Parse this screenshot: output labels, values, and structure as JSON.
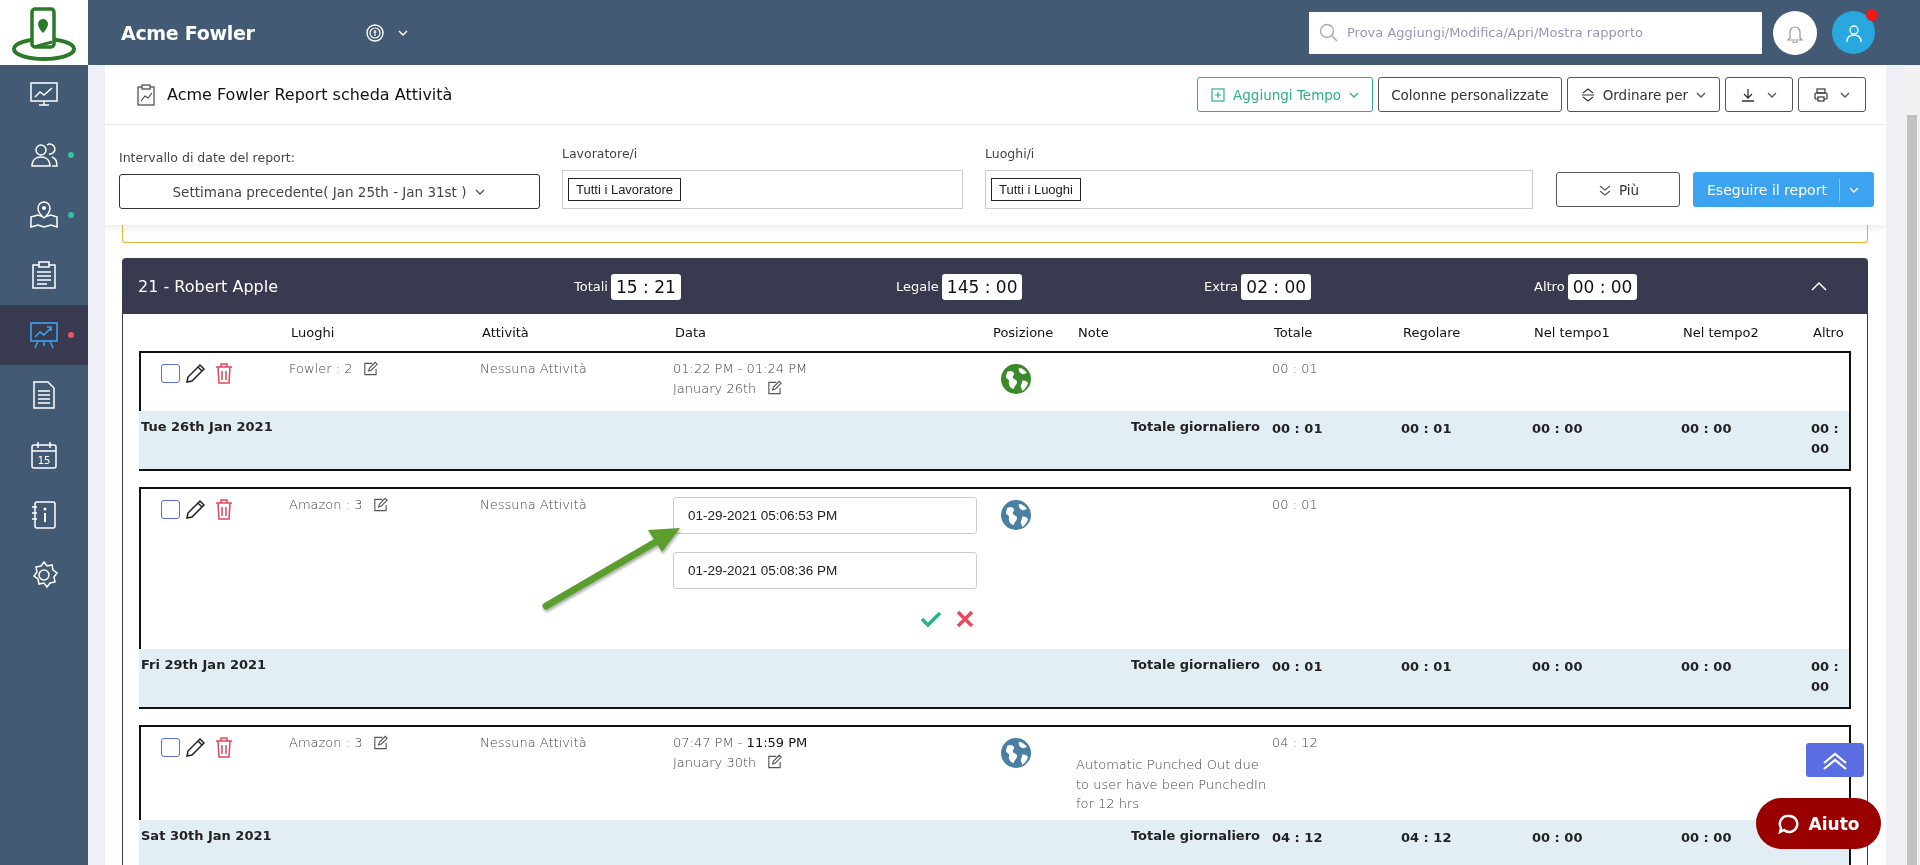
{
  "app": {
    "name": "Acme Fowler"
  },
  "search": {
    "placeholder": "Prova Aggiungi/Modifica/Apri/Mostra rapporto"
  },
  "profile": {
    "alert": true
  },
  "sidebar": {
    "items": [
      {
        "kind": "dashboard",
        "selected": false
      },
      {
        "kind": "people",
        "selected": false,
        "color": "#2ec4a0"
      },
      {
        "kind": "map",
        "selected": false,
        "color": "#2ec4a0"
      },
      {
        "kind": "clipboard",
        "selected": false
      },
      {
        "kind": "report",
        "selected": true,
        "color": "#f0506e"
      },
      {
        "kind": "document",
        "selected": false
      },
      {
        "kind": "calendar",
        "selected": false,
        "label": "15"
      },
      {
        "kind": "contacts",
        "selected": false
      },
      {
        "kind": "settings",
        "selected": false
      }
    ]
  },
  "report": {
    "title": "Acme Fowler Report scheda Attività",
    "toolbar": [
      {
        "kind": "add",
        "label": "Aggiungi Tempo",
        "dropdown": true
      },
      {
        "kind": "plain",
        "label": "Colonne personalizzate",
        "dropdown": false
      },
      {
        "kind": "sort",
        "label": "Ordinare per",
        "dropdown": true
      },
      {
        "kind": "download",
        "dropdown": true
      },
      {
        "kind": "print",
        "dropdown": true
      }
    ]
  },
  "filters": {
    "date_range": {
      "label": "Intervallo di date del report:",
      "value": "Settimana precedente( Jan 25th - Jan 31st )"
    },
    "workers": {
      "label": "Lavoratore/i",
      "tag": "Tutti i Lavoratore"
    },
    "places": {
      "label": "Luoghi/i",
      "tag": "Tutti i Luoghi"
    },
    "more_button": "Più",
    "run_button": "Eseguire il report"
  },
  "employee": {
    "name": "21 - Robert Apple",
    "expanded": true,
    "totals": [
      {
        "label": "Totali",
        "value": "15 : 21"
      },
      {
        "label": "Legale",
        "value": "145 : 00"
      },
      {
        "label": "Extra",
        "value": "02 : 00"
      },
      {
        "label": "Altro",
        "value": "00 : 00"
      }
    ],
    "columns": [
      "Luoghi",
      "Attività",
      "Data",
      "Posizione",
      "Note",
      "Totale",
      "Regolare",
      "Nel tempo1",
      "Nel tempo2",
      "Altro"
    ],
    "days": [
      {
        "entry": {
          "kind": "punch",
          "checked": false,
          "place": "Fowler : 2",
          "activity": "Nessuna Attività",
          "time": "01:22 PM - 01:24 PM",
          "date": "January 26th",
          "color": "#3b8a2a",
          "total": "00 : 01"
        },
        "summary": {
          "date": "Tue 26th Jan 2021",
          "label": "Totale giornaliero",
          "values": [
            "00 : 01",
            "00 : 01",
            "00 : 00",
            "00 : 00",
            "00 : 00"
          ]
        }
      },
      {
        "entry": {
          "kind": "editing",
          "checked": false,
          "place": "Amazon : 3",
          "activity": "Nessuna Attività",
          "start": "01-29-2021 05:06:53 PM",
          "end": "01-29-2021 05:08:36 PM",
          "color": "#4a7fa3",
          "total": "00 : 01"
        },
        "summary": {
          "date": "Fri 29th Jan 2021",
          "label": "Totale giornaliero",
          "values": [
            "00 : 01",
            "00 : 01",
            "00 : 00",
            "00 : 00",
            "00 : 00"
          ]
        }
      },
      {
        "entry": {
          "kind": "punch",
          "checked": false,
          "place": "Amazon : 3",
          "activity": "Nessuna Attività",
          "time": "07:47 PM - **11:59 PM**",
          "date": "January 30th",
          "color": "#4a7fa3",
          "note": "Automatic Punched Out due to user have been PunchedIn for 12 hrs",
          "total": "04 : 12"
        },
        "summary": {
          "date": "Sat 30th Jan 2021",
          "label": "Totale giornaliero",
          "values": [
            "04 : 12",
            "04 : 12",
            "00 : 00",
            "00 : 00"
          ]
        }
      }
    ]
  },
  "help_button": "Aiuto"
}
